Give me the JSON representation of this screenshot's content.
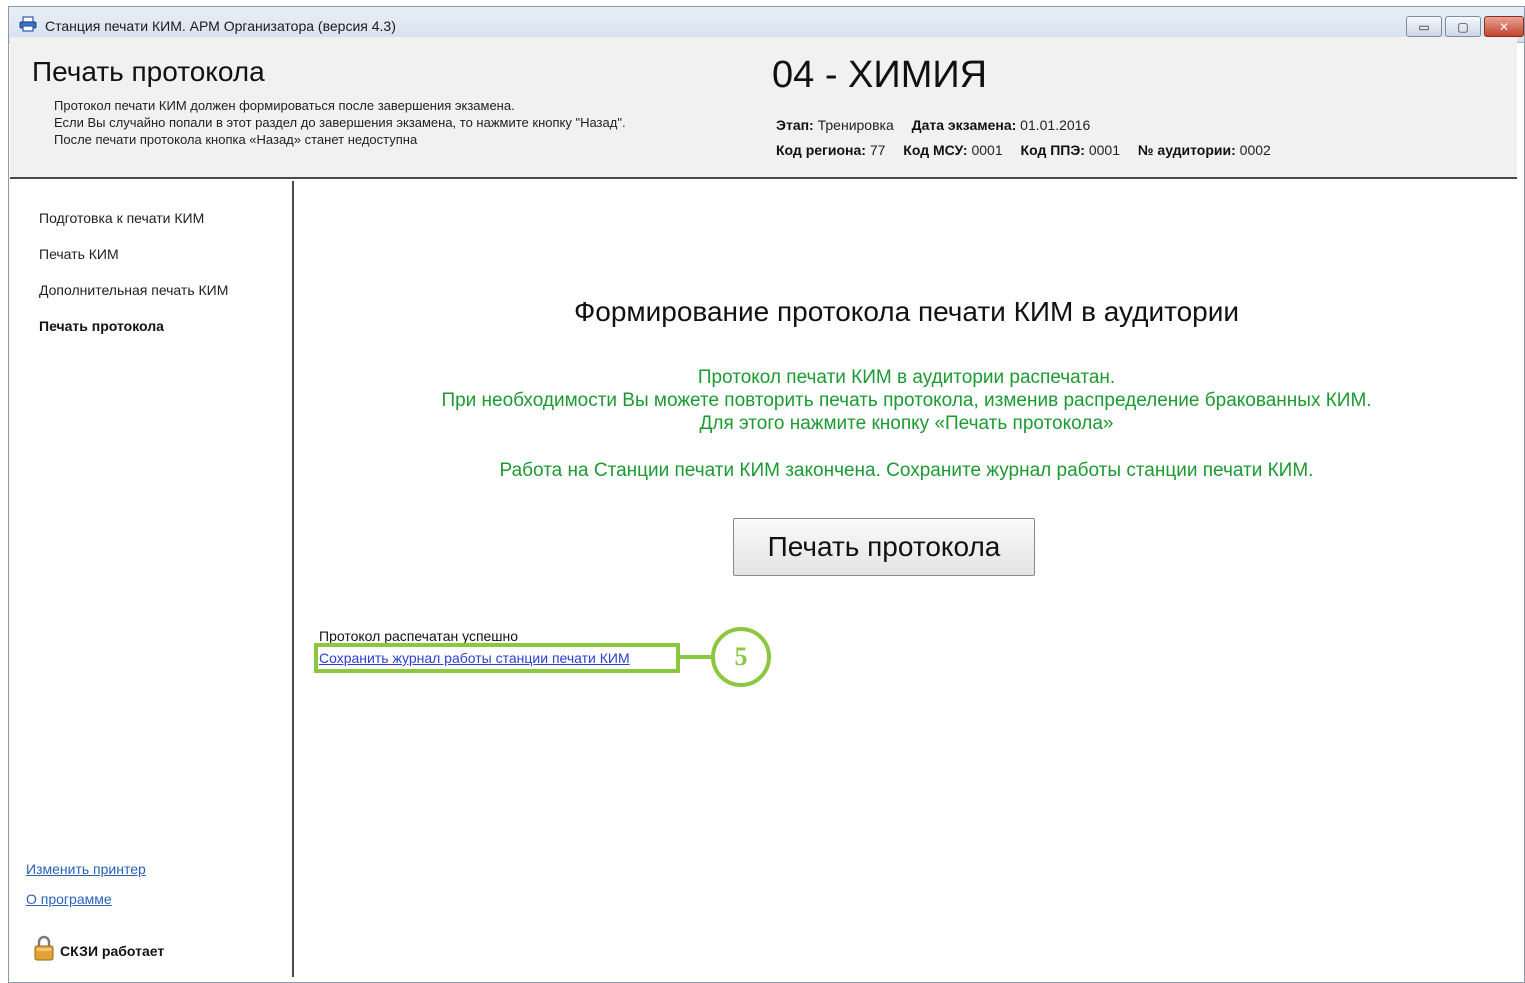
{
  "window": {
    "title": "Станция печати КИМ. АРМ Организатора (версия 4.3)",
    "controls": {
      "minimize": "▭",
      "maximize": "▢",
      "close": "✕"
    }
  },
  "header": {
    "page_title": "Печать протокола",
    "description": [
      "Протокол печати КИМ должен формироваться после завершения экзамена.",
      "Если Вы случайно попали в этот раздел до завершения экзамена, то нажмите кнопку \"Назад\".",
      "После печати протокола кнопка «Назад» станет недоступна"
    ],
    "subject": "04 - ХИМИЯ",
    "info": {
      "stage_label": "Этап:",
      "stage_value": "Тренировка",
      "exam_date_label": "Дата экзамена:",
      "exam_date_value": "01.01.2016",
      "region_label": "Код региона:",
      "region_value": "77",
      "msu_label": "Код МСУ:",
      "msu_value": "0001",
      "ppe_label": "Код ППЭ:",
      "ppe_value": "0001",
      "room_label": "№ аудитории:",
      "room_value": "0002"
    }
  },
  "sidebar": {
    "items": [
      {
        "label": "Подготовка к печати КИМ",
        "active": false
      },
      {
        "label": "Печать КИМ",
        "active": false
      },
      {
        "label": "Дополнительная печать КИМ",
        "active": false
      },
      {
        "label": "Печать протокола",
        "active": true
      }
    ],
    "change_printer": "Изменить принтер",
    "about": "О программе",
    "skzi_status": "СКЗИ работает"
  },
  "main": {
    "heading": "Формирование протокола печати КИМ в аудитории",
    "messages": [
      "Протокол печати КИМ в аудитории распечатан.",
      "При необходимости Вы можете повторить печать протокола, изменив распределение бракованных КИМ.",
      "Для этого нажмите кнопку «Печать протокола»",
      "Работа на Станции печати КИМ закончена. Сохраните журнал работы станции печати КИМ."
    ],
    "print_button": "Печать протокола",
    "status": "Протокол распечатан успешно",
    "save_log_link": "Сохранить журнал работы станции печати КИМ",
    "callout_number": "5"
  },
  "colors": {
    "message_green": "#1c9a32",
    "callout_green": "#8dc63f",
    "link_blue": "#2a3fd0"
  }
}
